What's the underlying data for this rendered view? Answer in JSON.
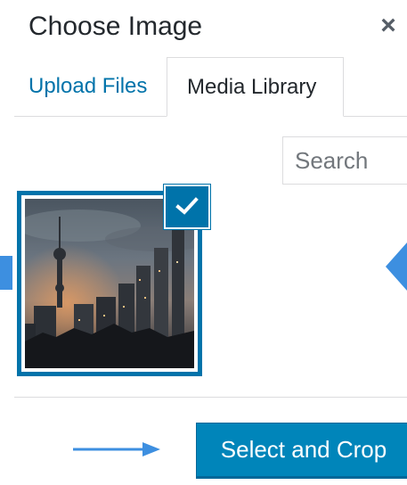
{
  "modal": {
    "title": "Choose Image",
    "close_glyph": "×"
  },
  "tabs": [
    {
      "label": "Upload Files",
      "active": false
    },
    {
      "label": "Media Library",
      "active": true
    }
  ],
  "search": {
    "placeholder": "Search",
    "value": ""
  },
  "attachment": {
    "selected": true,
    "thumbnail_subject": "city-skyline-at-dusk"
  },
  "toolbar": {
    "primary_label": "Select and Crop"
  },
  "colors": {
    "accent": "#0073aa",
    "primary_button": "#0085ba",
    "annotation_arrow": "#3d8fe0"
  },
  "icons": {
    "close": "close-icon",
    "check": "checkmark-icon"
  }
}
